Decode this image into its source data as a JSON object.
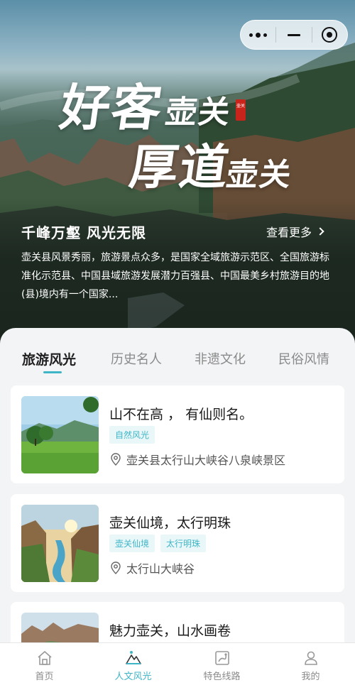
{
  "hero": {
    "calligraphy_line1": "好客",
    "calligraphy_line1_small": "壶关",
    "calligraphy_line2": "厚道",
    "calligraphy_line2_small": "壶关",
    "seal_text": "壶关",
    "title": "千峰万壑 风光无限",
    "see_more": "查看更多",
    "description": "壶关县风景秀丽，旅游景点众多，是国家全域旅游示范区、全国旅游标准化示范县、中国县域旅游发展潜力百强县、中国最美乡村旅游目的地(县)境内有一个国家..."
  },
  "capsule": {
    "more_icon": "more-dots-icon",
    "minimize_icon": "minus-icon",
    "close_icon": "target-icon"
  },
  "tabs": [
    {
      "label": "旅游风光",
      "active": true
    },
    {
      "label": "历史名人",
      "active": false
    },
    {
      "label": "非遗文化",
      "active": false
    },
    {
      "label": "民俗风情",
      "active": false
    }
  ],
  "cards": [
    {
      "title": "山不在高 ， 有仙则名。",
      "tags": [
        "自然风光"
      ],
      "location": "壶关县太行山大峡谷八泉峡景区"
    },
    {
      "title": "壶关仙境，太行明珠",
      "tags": [
        "壶关仙境",
        "太行明珠"
      ],
      "location": "太行山大峡谷"
    },
    {
      "title": "魅力壶关，山水画卷",
      "tags": [],
      "location": ""
    }
  ],
  "tabbar": [
    {
      "label": "首页",
      "icon": "home-icon",
      "active": false
    },
    {
      "label": "人文风光",
      "icon": "mountain-icon",
      "active": true
    },
    {
      "label": "特色线路",
      "icon": "route-map-icon",
      "active": false
    },
    {
      "label": "我的",
      "icon": "user-icon",
      "active": false
    }
  ],
  "colors": {
    "accent": "#3fb6c8",
    "tag_bg": "#eaf7f9",
    "seal": "#c8241c"
  }
}
